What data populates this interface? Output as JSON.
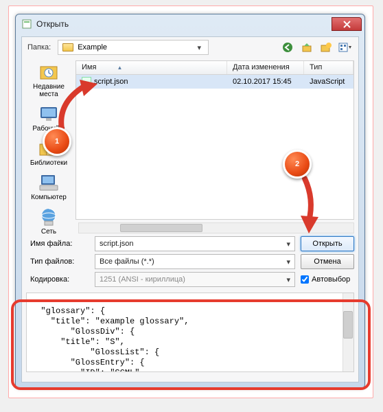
{
  "window": {
    "title": "Открыть"
  },
  "folderbar": {
    "label": "Папка:",
    "current": "Example"
  },
  "places": [
    {
      "label": "Недавние\nместа",
      "icon": "recent"
    },
    {
      "label": "Рабочий с",
      "icon": "desktop"
    },
    {
      "label": "Библиотеки",
      "icon": "libraries"
    },
    {
      "label": "Компьютер",
      "icon": "computer"
    },
    {
      "label": "Сеть",
      "icon": "network"
    }
  ],
  "columns": {
    "name": "Имя",
    "modified": "Дата изменения",
    "type": "Тип"
  },
  "files": [
    {
      "name": "script.json",
      "modified": "02.10.2017 15:45",
      "type": "JavaScript"
    }
  ],
  "form": {
    "filename_label": "Имя файла:",
    "filename_value": "script.json",
    "filetype_label": "Тип файлов:",
    "filetype_value": "Все файлы (*.*)",
    "encoding_label": "Кодировка:",
    "encoding_value": "1251 (ANSI - кириллица)",
    "open": "Открыть",
    "cancel": "Отмена",
    "autodetect": "Автовыбор"
  },
  "preview_text": "\n  \"glossary\": {\n    \"title\": \"example glossary\",\n        \"GlossDiv\": {\n      \"title\": \"S\",\n            \"GlossList\": {\n        \"GlossEntry\": {\n          \"ID\": \"SGML\",\n                    \"SortAs\": \"SG",
  "callouts": {
    "one": "1",
    "two": "2"
  }
}
